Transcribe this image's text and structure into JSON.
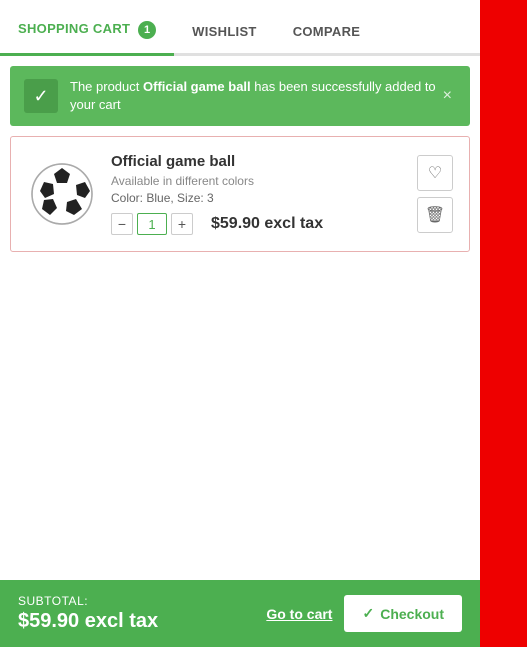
{
  "tabs": [
    {
      "id": "shopping-cart",
      "label": "SHOPPING CART",
      "badge": "1",
      "active": true
    },
    {
      "id": "wishlist",
      "label": "WISHLIST",
      "badge": null,
      "active": false
    },
    {
      "id": "compare",
      "label": "COMPARE",
      "badge": null,
      "active": false
    }
  ],
  "success_message": {
    "prefix": "The product ",
    "product_name": "Official game ball",
    "suffix": " has been successfully added to your cart",
    "close_label": "×"
  },
  "cart": {
    "items": [
      {
        "name": "Official game ball",
        "subtitle": "Available in different colors",
        "meta": "Color: Blue, Size: 3",
        "price": "$59.90 excl tax",
        "qty": "1"
      }
    ]
  },
  "footer": {
    "subtotal_label": "SUBTOTAL:",
    "subtotal_amount": "$59.90 excl tax",
    "go_to_cart_label": "Go to cart",
    "checkout_label": "Checkout"
  },
  "icons": {
    "check": "✓",
    "close": "×",
    "heart": "♡",
    "trash": "🗑",
    "minus": "−",
    "plus": "+"
  },
  "colors": {
    "green": "#4caf50",
    "red_bar": "#dd0000",
    "border_red": "#e8b0b0"
  }
}
